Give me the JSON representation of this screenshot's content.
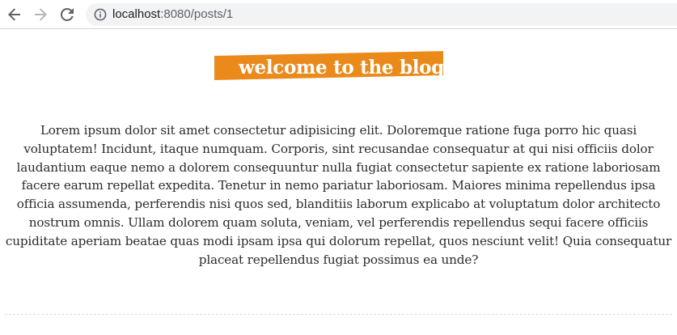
{
  "browser": {
    "back_icon": "arrow-left-icon",
    "forward_icon": "arrow-right-icon",
    "reload_icon": "reload-icon",
    "site_info_icon": "info-circle-icon",
    "url_host": "localhost",
    "url_rest": ":8080/posts/1"
  },
  "page": {
    "title": "welcome to the blog",
    "title_bg_color": "#ea8a1b",
    "body": "Lorem ipsum dolor sit amet consectetur adipisicing elit. Doloremque ratione fuga porro hic quasi voluptatem! Incidunt, itaque numquam. Corporis, sint recusandae consequatur at qui nisi officiis dolor laudantium eaque nemo a dolorem consequuntur nulla fugiat consectetur sapiente ex ratione laboriosam facere earum repellat expedita. Tenetur in nemo pariatur laboriosam. Maiores minima repellendus ipsa officia assumenda, perferendis nisi quos sed, blanditiis laborum explicabo at voluptatum dolor architecto nostrum omnis. Ullam dolorem quam soluta, veniam, vel perferendis repellendus sequi facere officiis cupiditate aperiam beatae quas modi ipsam ipsa qui dolorum repellat, quos nesciunt velit! Quia consequatur placeat repellendus fugiat possimus ea unde?"
  }
}
